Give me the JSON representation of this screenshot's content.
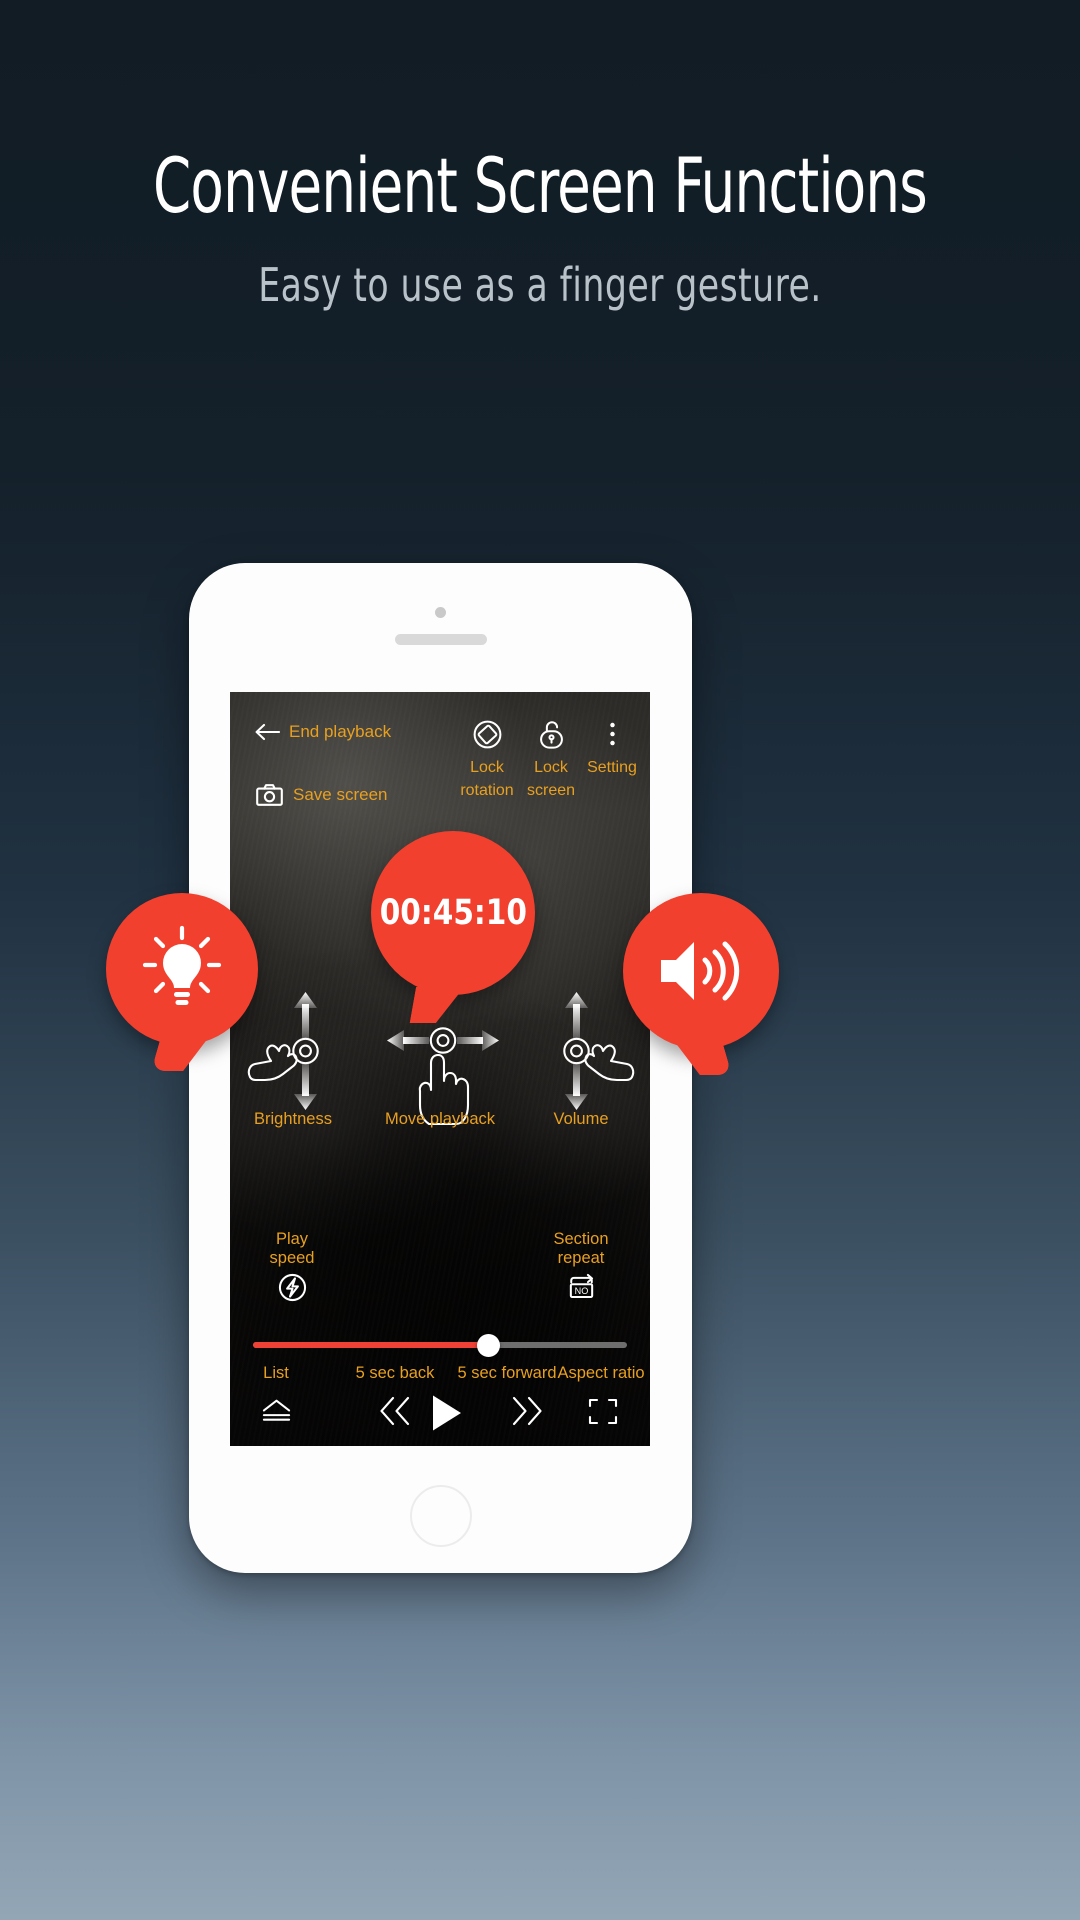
{
  "hero": {
    "title": "Convenient Screen Functions",
    "subtitle": "Easy to use as a finger gesture."
  },
  "colors": {
    "accent_red": "#f2402f",
    "amber_label": "#e8a020",
    "progress_fill": "#ef4136",
    "progress_track": "#6e6e6e",
    "page_bg_top": "#111c24",
    "page_bg_bottom": "#93a6b6"
  },
  "player": {
    "top_bar": {
      "back_label": "End playback",
      "back_icon": "arrow-left-icon",
      "save_label": "Save screen",
      "save_icon": "camera-icon",
      "actions": [
        {
          "label": "Lock\nrotation",
          "label_line1": "Lock",
          "label_line2": "rotation",
          "icon": "screen-rotation-lock-icon"
        },
        {
          "label": "Lock\nscreen",
          "label_line1": "Lock",
          "label_line2": "screen",
          "icon": "padlock-icon"
        },
        {
          "label": "Setting",
          "label_line1": "Setting",
          "label_line2": "",
          "icon": "overflow-menu-icon"
        }
      ]
    },
    "bubbles": [
      {
        "name": "brightness-bubble",
        "icon": "lightbulb-icon",
        "text": ""
      },
      {
        "name": "seek-time-bubble",
        "icon": "",
        "text": "00:45:10"
      },
      {
        "name": "volume-bubble",
        "icon": "speaker-volume-icon",
        "text": ""
      }
    ],
    "gestures": [
      {
        "label": "Brightness",
        "icon": "hand-swipe-vertical-icon",
        "direction": "vertical"
      },
      {
        "label": "Move playback",
        "icon": "hand-swipe-horizontal-icon",
        "direction": "horizontal"
      },
      {
        "label": "Volume",
        "icon": "hand-swipe-vertical-icon",
        "direction": "vertical"
      }
    ],
    "quick_actions": {
      "play_speed_line1": "Play",
      "play_speed_line2": "speed",
      "play_speed_icon": "lightning-bolt-circle-icon",
      "section_repeat_line1": "Section",
      "section_repeat_line2": "repeat",
      "section_repeat_icon": "repeat-no-icon"
    },
    "progress": {
      "percent": 63,
      "elapsed": "00:45:10"
    },
    "transport": [
      {
        "label": "List",
        "icon": "eject-list-icon"
      },
      {
        "label": "5 sec back",
        "icon": "rewind-double-chevron-icon"
      },
      {
        "label": "",
        "icon": "play-icon"
      },
      {
        "label": "5 sec forward",
        "icon": "forward-double-chevron-icon"
      },
      {
        "label": "Aspect ratio",
        "icon": "aspect-ratio-frame-icon"
      }
    ]
  }
}
